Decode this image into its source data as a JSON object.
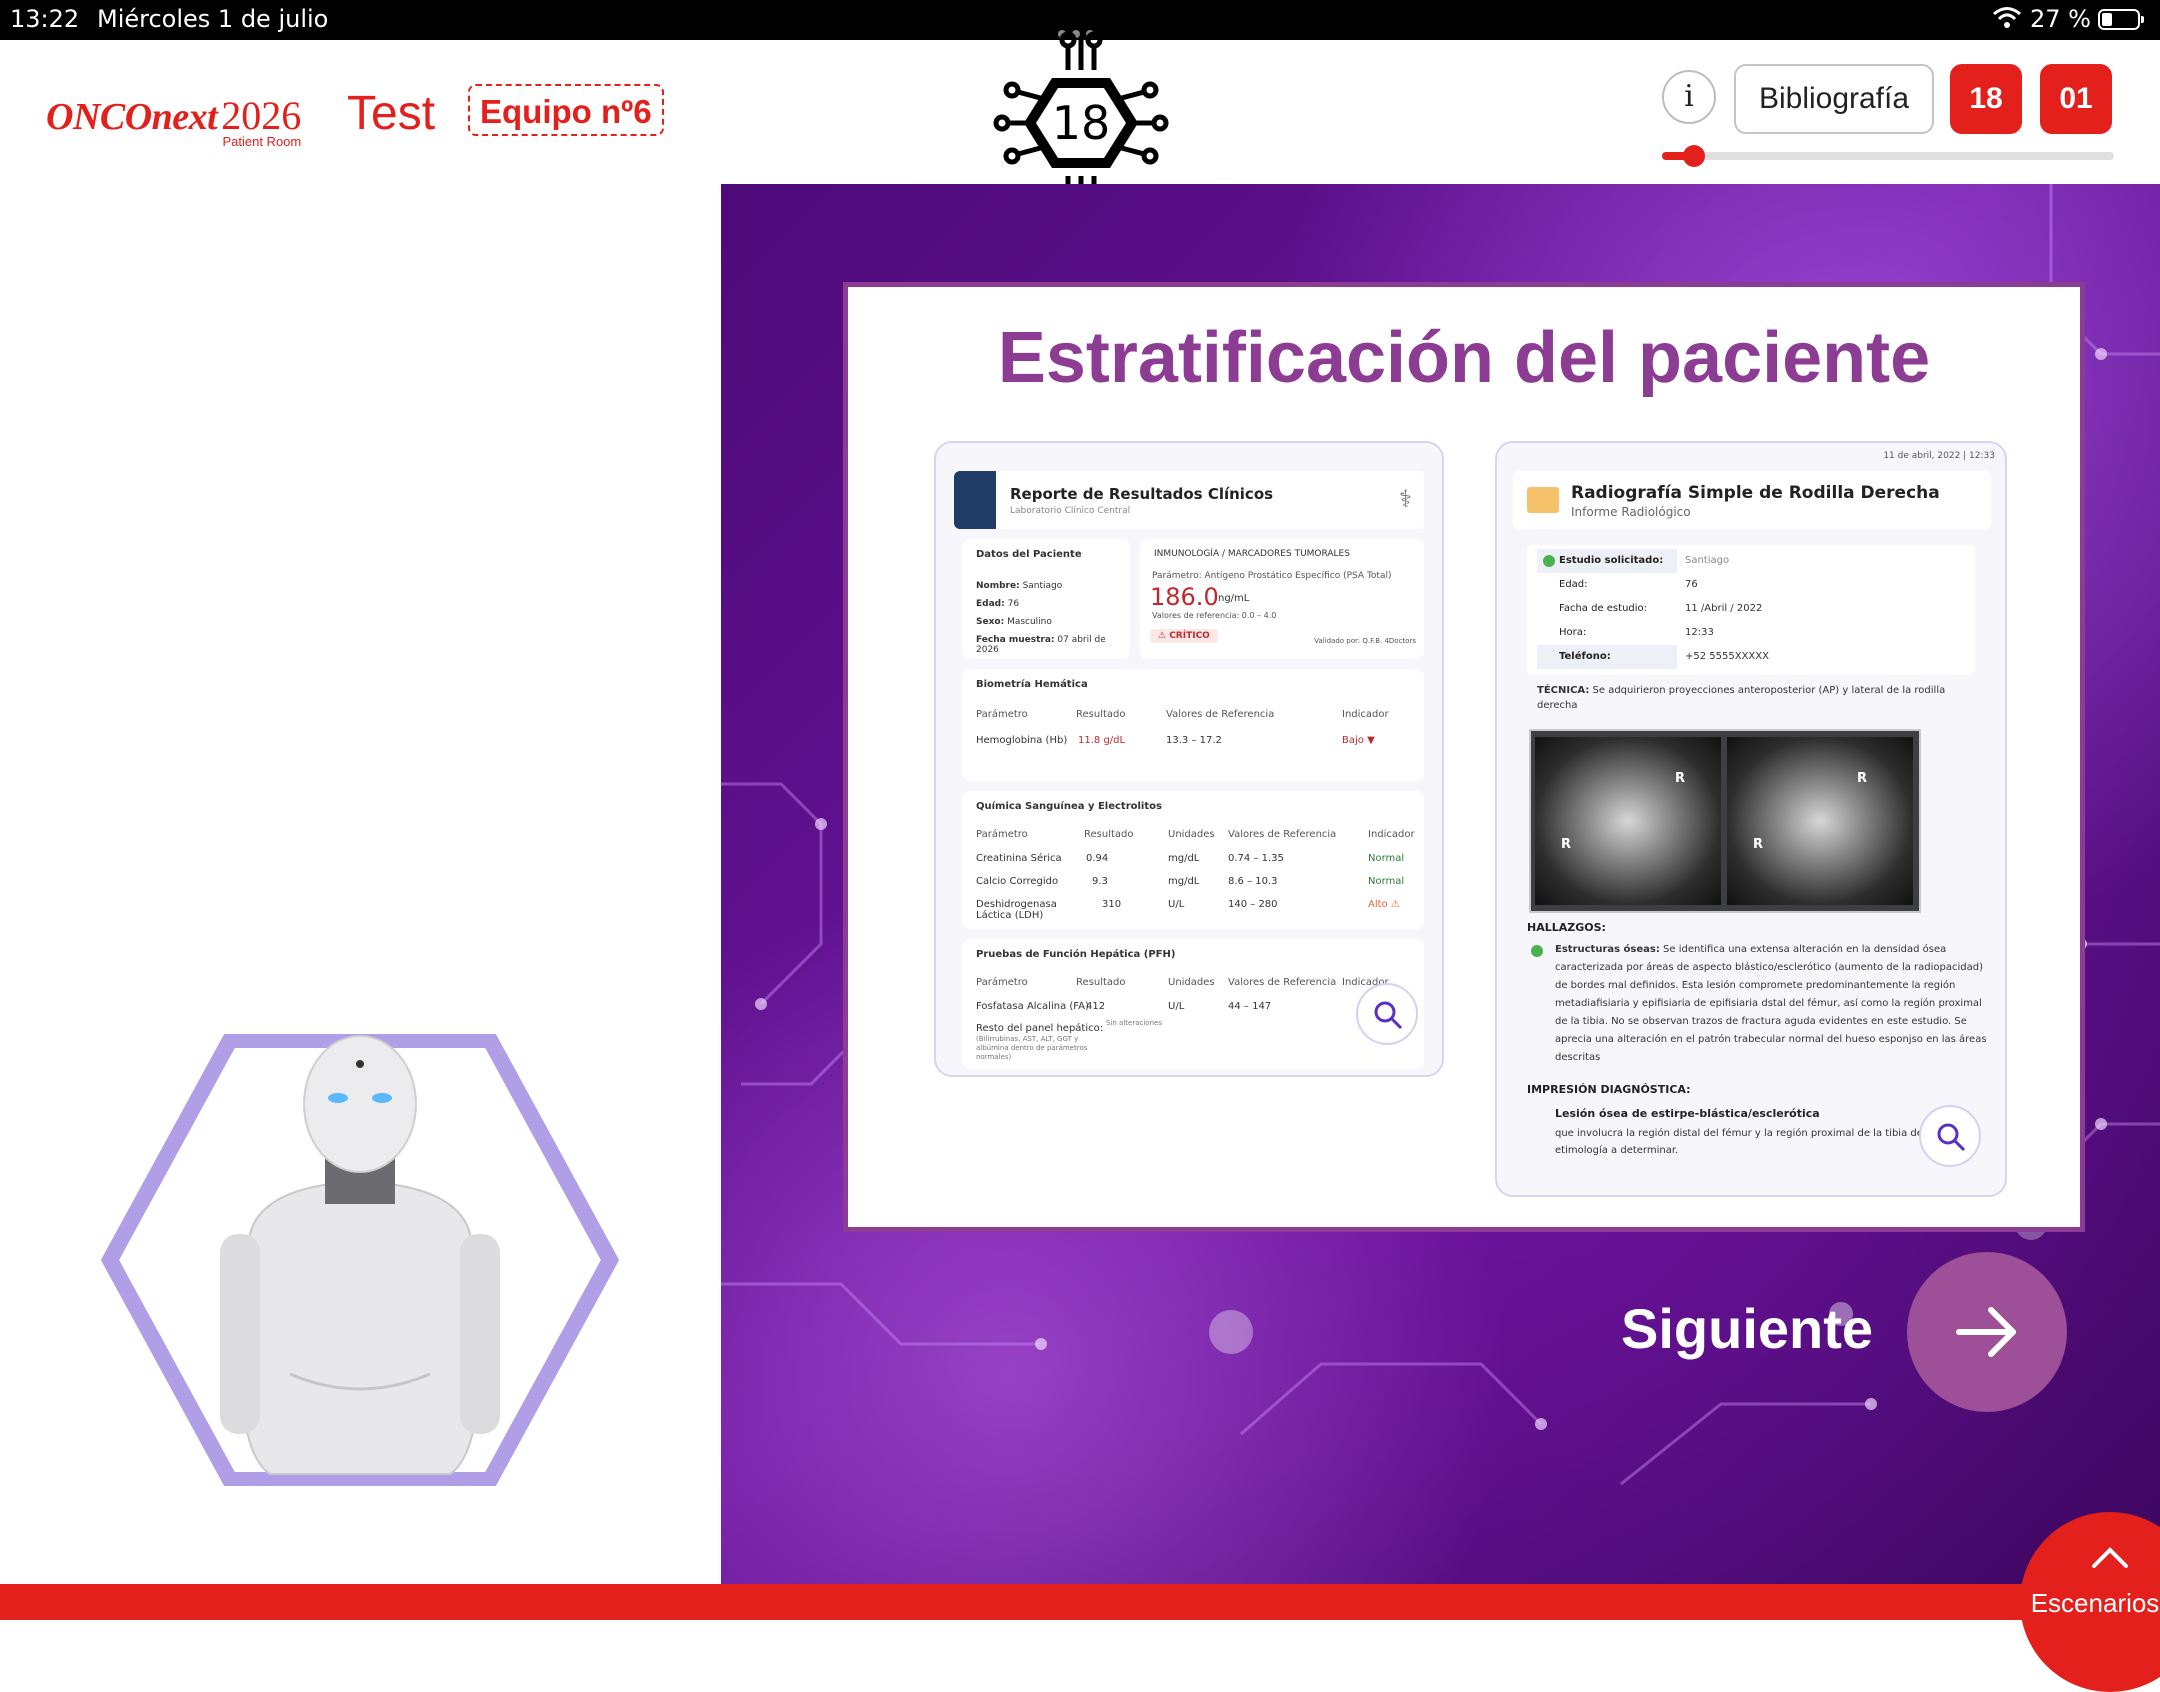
{
  "status_bar": {
    "time": "13:22",
    "date": "Miércoles 1 de julio",
    "battery": "27 %"
  },
  "header": {
    "logo_brand": "ONCOnext",
    "logo_year": "2026",
    "logo_sub": "Patient Room",
    "mode": "Test",
    "team": "Equipo nº6",
    "chip_number": "18",
    "info_label": "i",
    "bibliography_label": "Bibliografía",
    "counter_a": "18",
    "counter_b": "01",
    "progress_fraction": 0.07
  },
  "slide": {
    "title": "Estratificación del paciente",
    "lab": {
      "title": "Reporte de Resultados Clínicos",
      "subtitle": "Laboratorio Clínico Central",
      "patient_box": "Datos del Paciente",
      "name_k": "Nombre:",
      "name_v": "Santiago",
      "age_k": "Edad:",
      "age_v": "76",
      "sex_k": "Sexo:",
      "sex_v": "Masculino",
      "date_k": "Fecha muestra:",
      "date_v": "07 abril de 2026",
      "immuno_box": "INMUNOLOGÍA / MARCADORES TUMORALES",
      "psa_param": "Parámetro: Antígeno Prostático Específico (PSA Total)",
      "psa_value": "186.0",
      "psa_unit": "ng/mL",
      "psa_ref": "Valores de referencia: 0.0 – 4.0",
      "critical": "⚠ CRÍTICO",
      "validated": "Validado por: Q.F.B. 4Doctors",
      "bio_title": "Biometría Hemática",
      "bio_headers": [
        "Parámetro",
        "Resultado",
        "Valores de Referencia",
        "Indicador"
      ],
      "bio_row": [
        "Hemoglobina (Hb)",
        "11.8  g/dL",
        "13.3 – 17.2",
        "Bajo ▼"
      ],
      "chem_title": "Química Sanguínea y Electrolitos",
      "chem_headers": [
        "Parámetro",
        "Resultado",
        "Unidades",
        "Valores de Referencia",
        "Indicador"
      ],
      "chem_rows": [
        [
          "Creatinina Sérica",
          "0.94",
          "mg/dL",
          "0.74 – 1.35",
          "Normal"
        ],
        [
          "Calcio Corregido",
          "9.3",
          "mg/dL",
          "8.6 – 10.3",
          "Normal"
        ],
        [
          "Deshidrogenasa Láctica (LDH)",
          "310",
          "U/L",
          "140 – 280",
          "Alto ⚠"
        ]
      ],
      "liver_title": "Pruebas de Función Hepática (PFH)",
      "liver_headers": [
        "Parámetro",
        "Resultado",
        "Unidades",
        "Valores de Referencia",
        "Indicador"
      ],
      "liver_row": [
        "Fosfatasa Alcalina (FA)",
        "412",
        "U/L",
        "44 – 147"
      ],
      "liver_rest": "Resto del panel hepático:",
      "liver_rest_sub": "(Bilirrubinas, AST, ALT, GGT y albúmina dentro de parámetros normales)",
      "liver_rest_val": "Sin alteraciones"
    },
    "rad": {
      "date": "11 de abril, 2022 | 12:33",
      "title": "Radiografía Simple de Rodilla Derecha",
      "subtitle": "Informe Radiológico",
      "fields": [
        {
          "k": "Estudio solicitado:",
          "v": "Santiago"
        },
        {
          "k": "Edad:",
          "v": "76"
        },
        {
          "k": "Facha de estudio:",
          "v": "11 /Abril / 2022"
        },
        {
          "k": "Hora:",
          "v": "12:33"
        },
        {
          "k": "Teléfono:",
          "v": "+52 5555XXXXX"
        }
      ],
      "tecnica_k": "TÉCNICA:",
      "tecnica_v": "Se adquirieron proyecciones anteroposterior (AP) y lateral de la rodilla derecha",
      "xray_mark": "R",
      "hallazgos": "HALLAZGOS:",
      "findings_k": "Estructuras óseas:",
      "findings_v": "Se identifica una extensa alteración en la densidad ósea caracterizada por áreas de aspecto blástico/esclerótico (aumento de la radiopacidad) de bordes mal definidos. Esta lesión compromete predominantemente la región metadiafisiaria y epifisiaria de epifisiaria dstal del fémur, así como la región proximal de la tibia. No se observan trazos de fractura aguda evidentes en este estudio. Se aprecia una alteración en el patrón trabecular normal del hueso esponjso en las áreas descritas",
      "impresion": "IMPRESIÓN DIAGNÓSTICA:",
      "imp_title": "Lesión ósea de estirpe-blástica/esclerótica",
      "imp_body": "que involucra la región distal del fémur y la región proximal de la tibia derecha, de etimología a determinar."
    },
    "next_label": "Siguiente"
  },
  "footer": {
    "scenarios_label": "Escenarios"
  },
  "colors": {
    "brand_red": "#e3201b",
    "title_purple": "#8c3d93",
    "hex_lavender": "#b09fe6"
  }
}
